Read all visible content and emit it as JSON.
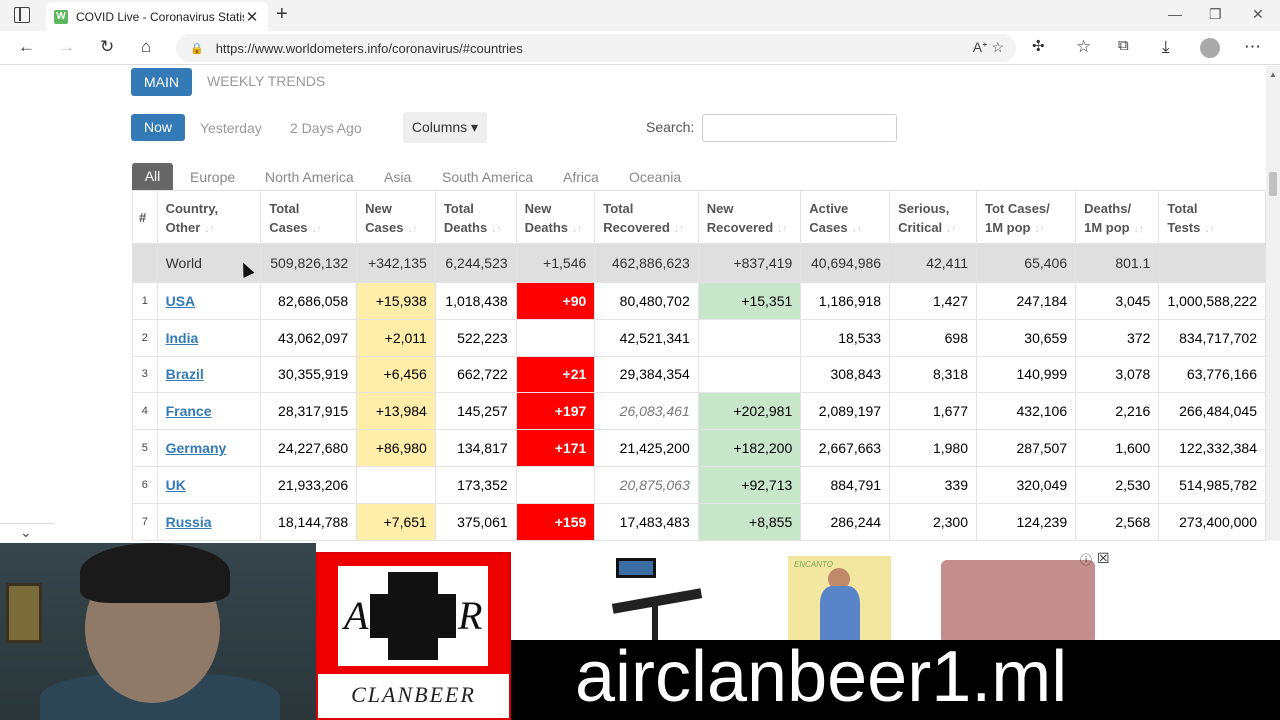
{
  "browser": {
    "tab_title": "COVID Live - Coronavirus Statisti",
    "tab_favicon": "W",
    "url": "https://www.worldometers.info/coronavirus/#countries"
  },
  "page": {
    "view_tabs": [
      "MAIN",
      "WEEKLY TRENDS"
    ],
    "time_tabs": [
      "Now",
      "Yesterday",
      "2 Days Ago"
    ],
    "columns_label": "Columns ▾",
    "search_label": "Search:",
    "region_tabs": [
      "All",
      "Europe",
      "North America",
      "Asia",
      "South America",
      "Africa",
      "Oceania"
    ]
  },
  "table": {
    "headers": [
      [
        "#",
        ""
      ],
      [
        "Country,",
        "Other"
      ],
      [
        "Total",
        "Cases"
      ],
      [
        "New",
        "Cases"
      ],
      [
        "Total",
        "Deaths"
      ],
      [
        "New",
        "Deaths"
      ],
      [
        "Total",
        "Recovered"
      ],
      [
        "New",
        "Recovered"
      ],
      [
        "Active",
        "Cases"
      ],
      [
        "Serious,",
        "Critical"
      ],
      [
        "Tot Cases/",
        "1M pop"
      ],
      [
        "Deaths/",
        "1M pop"
      ],
      [
        "Total",
        "Tests"
      ]
    ],
    "world": [
      "",
      "World",
      "509,826,132",
      "+342,135",
      "6,244,523",
      "+1,546",
      "462,886,623",
      "+837,419",
      "40,694,986",
      "42,411",
      "65,406",
      "801.1",
      ""
    ],
    "rows": [
      [
        "1",
        "USA",
        "82,686,058",
        "+15,938",
        "1,018,438",
        "+90",
        "80,480,702",
        "+15,351",
        "1,186,918",
        "1,427",
        "247,184",
        "3,045",
        "1,000,588,222"
      ],
      [
        "2",
        "India",
        "43,062,097",
        "+2,011",
        "522,223",
        "",
        "42,521,341",
        "",
        "18,533",
        "698",
        "30,659",
        "372",
        "834,717,702"
      ],
      [
        "3",
        "Brazil",
        "30,355,919",
        "+6,456",
        "662,722",
        "+21",
        "29,384,354",
        "",
        "308,843",
        "8,318",
        "140,999",
        "3,078",
        "63,776,166"
      ],
      [
        "4",
        "France",
        "28,317,915",
        "+13,984",
        "145,257",
        "+197",
        "26,083,461",
        "+202,981",
        "2,089,197",
        "1,677",
        "432,106",
        "2,216",
        "266,484,045"
      ],
      [
        "5",
        "Germany",
        "24,227,680",
        "+86,980",
        "134,817",
        "+171",
        "21,425,200",
        "+182,200",
        "2,667,663",
        "1,980",
        "287,507",
        "1,600",
        "122,332,384"
      ],
      [
        "6",
        "UK",
        "21,933,206",
        "",
        "173,352",
        "",
        "20,875,063",
        "+92,713",
        "884,791",
        "339",
        "320,049",
        "2,530",
        "514,985,782"
      ],
      [
        "7",
        "Russia",
        "18,144,788",
        "+7,651",
        "375,061",
        "+159",
        "17,483,483",
        "+8,855",
        "286,244",
        "2,300",
        "124,239",
        "2,568",
        "273,400,000"
      ]
    ]
  },
  "overlay": {
    "logo_letters": [
      "A",
      "R"
    ],
    "logo_text": "CLANBEER",
    "banner_text": "airclanbeer1.ml",
    "ad_brand": "ENCANTO"
  }
}
